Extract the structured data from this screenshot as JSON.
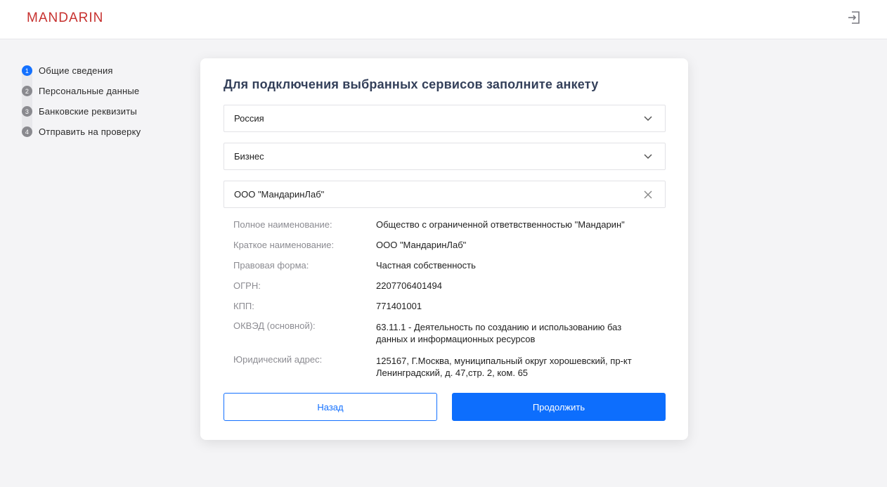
{
  "header": {
    "logo": "MANDARIN",
    "logout_icon": "logout-icon"
  },
  "steps": [
    {
      "num": "1",
      "label": "Общие сведения",
      "active": true
    },
    {
      "num": "2",
      "label": "Персональные данные",
      "active": false
    },
    {
      "num": "3",
      "label": "Банковские реквизиты",
      "active": false
    },
    {
      "num": "4",
      "label": "Отправить на проверку",
      "active": false
    }
  ],
  "form": {
    "title": "Для подключения выбранных сервисов заполните анкету",
    "country": {
      "value": "Россия",
      "icon": "chevron-down-icon"
    },
    "type": {
      "value": "Бизнес",
      "icon": "chevron-down-icon"
    },
    "company": {
      "value": "ООО \"МандаринЛаб\"",
      "icon": "close-icon"
    },
    "details": [
      {
        "label": "Полное наименование:",
        "value": "Общество с ограниченной ответвственностью \"Мандарин\""
      },
      {
        "label": "Краткое наименование:",
        "value": "ООО \"МандаринЛаб\""
      },
      {
        "label": "Правовая форма:",
        "value": "Частная собственность"
      },
      {
        "label": "ОГРН:",
        "value": "2207706401494"
      },
      {
        "label": "КПП:",
        "value": "771401001"
      },
      {
        "label": "ОКВЭД (основной):",
        "value": "63.11.1 - Деятельность по созданию и использованию баз данных и информационных ресурсов"
      },
      {
        "label": "Юридический адрес:",
        "value": "125167, Г.Москва, муниципальный округ хорошевский, пр-кт Ленинградский, д. 47,стр. 2, ком. 65"
      }
    ],
    "back_label": "Назад",
    "next_label": "Продолжить"
  },
  "colors": {
    "accent": "#0d6efd",
    "logo": "#c7312f",
    "background": "#f4f4f6"
  }
}
